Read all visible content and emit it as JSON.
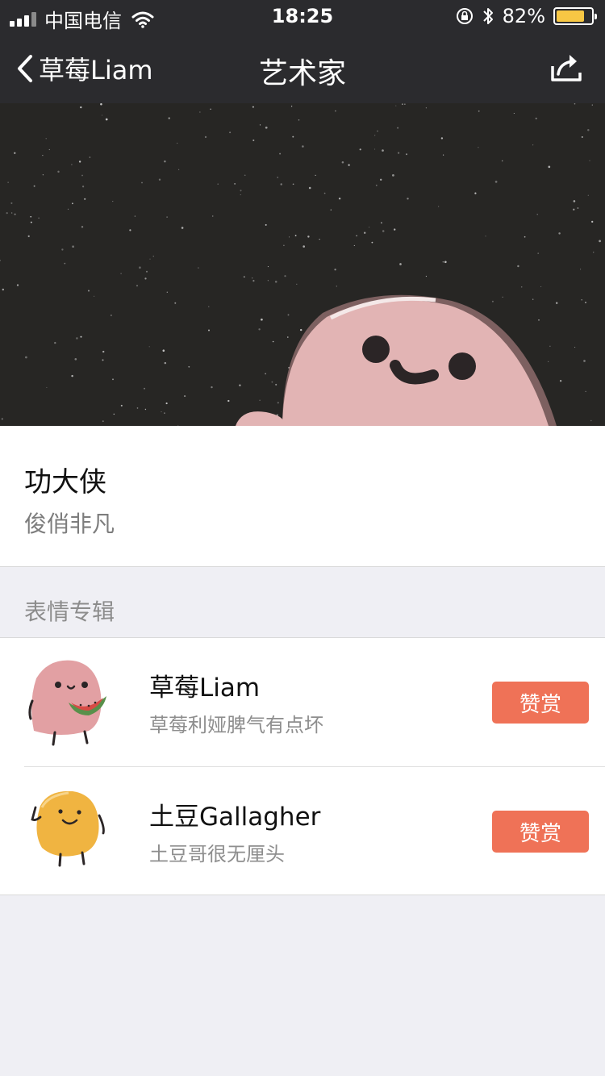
{
  "status_bar": {
    "carrier": "中国电信",
    "time": "18:25",
    "battery_percent": "82%",
    "battery_level": 0.82,
    "battery_color": "#f7c744"
  },
  "nav": {
    "back_label": "草莓Liam",
    "title": "艺术家",
    "back_icon": "chevron-left-icon",
    "share_icon": "share-icon"
  },
  "artist": {
    "name": "功大侠",
    "description": "俊俏非凡"
  },
  "section": {
    "title": "表情专辑"
  },
  "albums": [
    {
      "title": "草莓Liam",
      "subtitle": "草莓利娅脾气有点坏",
      "button": "赞赏",
      "thumb_icon": "pink-potato-watermelon-icon"
    },
    {
      "title": "土豆Gallagher",
      "subtitle": "土豆哥很无厘头",
      "button": "赞赏",
      "thumb_icon": "yellow-potato-icon"
    }
  ],
  "colors": {
    "nav_bg": "#2b2b2e",
    "banner_bg": "#272624",
    "accent": "#ef7257",
    "pink_character": "#e2b4b4",
    "yellow_character": "#f0b441"
  }
}
